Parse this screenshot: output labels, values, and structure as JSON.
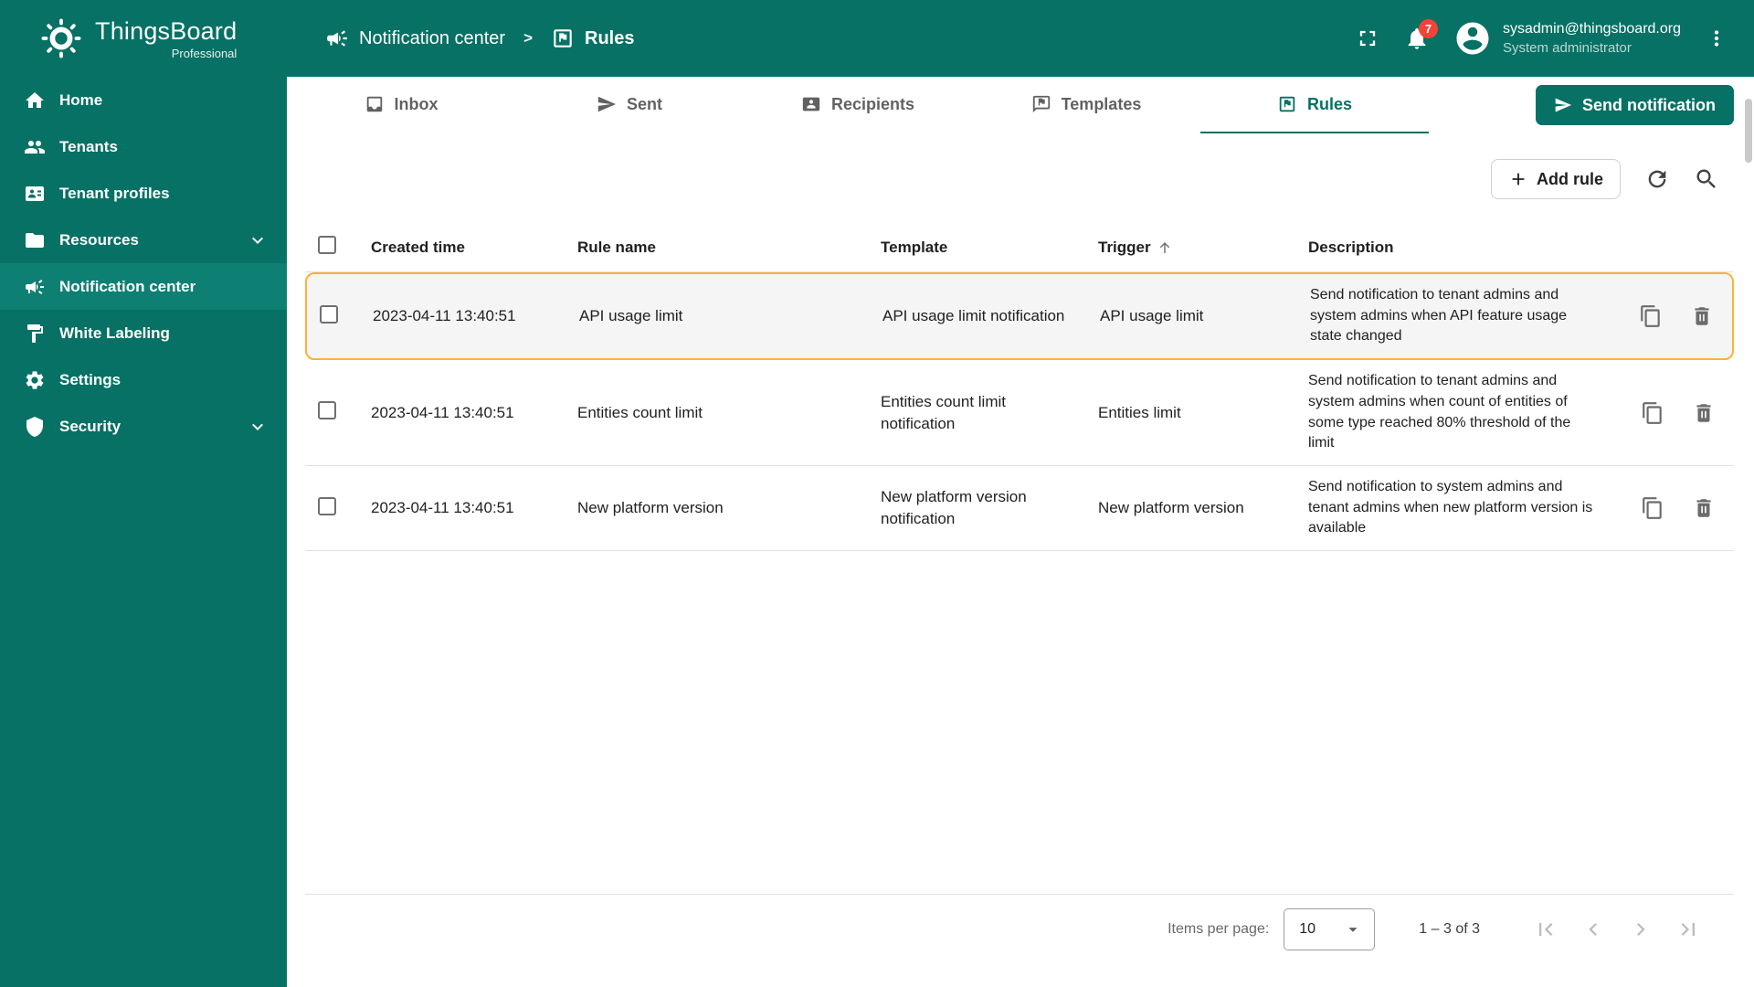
{
  "app": {
    "name": "ThingsBoard",
    "edition": "Professional"
  },
  "breadcrumb": {
    "separator": ">",
    "items": [
      {
        "label": "Notification center",
        "icon": "notification-center-icon"
      },
      {
        "label": "Rules",
        "icon": "rules-icon"
      }
    ]
  },
  "header": {
    "notifications_badge": "7",
    "user_email": "sysadmin@thingsboard.org",
    "user_role": "System administrator"
  },
  "colors": {
    "primary": "#067164",
    "highlight_border": "#ffb03a",
    "badge": "#f44336"
  },
  "sidebar": {
    "items": [
      {
        "label": "Home",
        "icon": "home-icon"
      },
      {
        "label": "Tenants",
        "icon": "tenants-icon"
      },
      {
        "label": "Tenant profiles",
        "icon": "tenant-profiles-icon"
      },
      {
        "label": "Resources",
        "icon": "folder-icon",
        "expandable": true
      },
      {
        "label": "Notification center",
        "icon": "notification-center-icon",
        "active": true
      },
      {
        "label": "White Labeling",
        "icon": "white-labeling-icon"
      },
      {
        "label": "Settings",
        "icon": "settings-icon"
      },
      {
        "label": "Security",
        "icon": "security-icon",
        "expandable": true
      }
    ]
  },
  "tabs": [
    {
      "label": "Inbox",
      "icon": "inbox-icon"
    },
    {
      "label": "Sent",
      "icon": "sent-icon"
    },
    {
      "label": "Recipients",
      "icon": "recipients-icon"
    },
    {
      "label": "Templates",
      "icon": "templates-icon"
    },
    {
      "label": "Rules",
      "icon": "rules-icon",
      "active": true
    }
  ],
  "actions": {
    "send_notification": "Send notification",
    "add_rule": "Add rule"
  },
  "table": {
    "columns": {
      "created_time": "Created time",
      "rule_name": "Rule name",
      "template": "Template",
      "trigger": "Trigger",
      "description": "Description"
    },
    "sorted_by": "Trigger",
    "sort_direction": "asc",
    "rows": [
      {
        "created_time": "2023-04-11 13:40:51",
        "rule_name": "API usage limit",
        "template": "API usage limit notification",
        "trigger": "API usage limit",
        "description": "Send notification to tenant admins and system admins when API feature usage state changed",
        "highlighted": true
      },
      {
        "created_time": "2023-04-11 13:40:51",
        "rule_name": "Entities count limit",
        "template": "Entities count limit notification",
        "trigger": "Entities limit",
        "description": "Send notification to tenant admins and system admins when count of entities of some type reached 80% threshold of the limit",
        "highlighted": false
      },
      {
        "created_time": "2023-04-11 13:40:51",
        "rule_name": "New platform version",
        "template": "New platform version notification",
        "trigger": "New platform version",
        "description": "Send notification to system admins and tenant admins when new platform version is available",
        "highlighted": false
      }
    ]
  },
  "pagination": {
    "items_per_page_label": "Items per page:",
    "items_per_page_value": "10",
    "range_label": "1 – 3 of 3"
  }
}
